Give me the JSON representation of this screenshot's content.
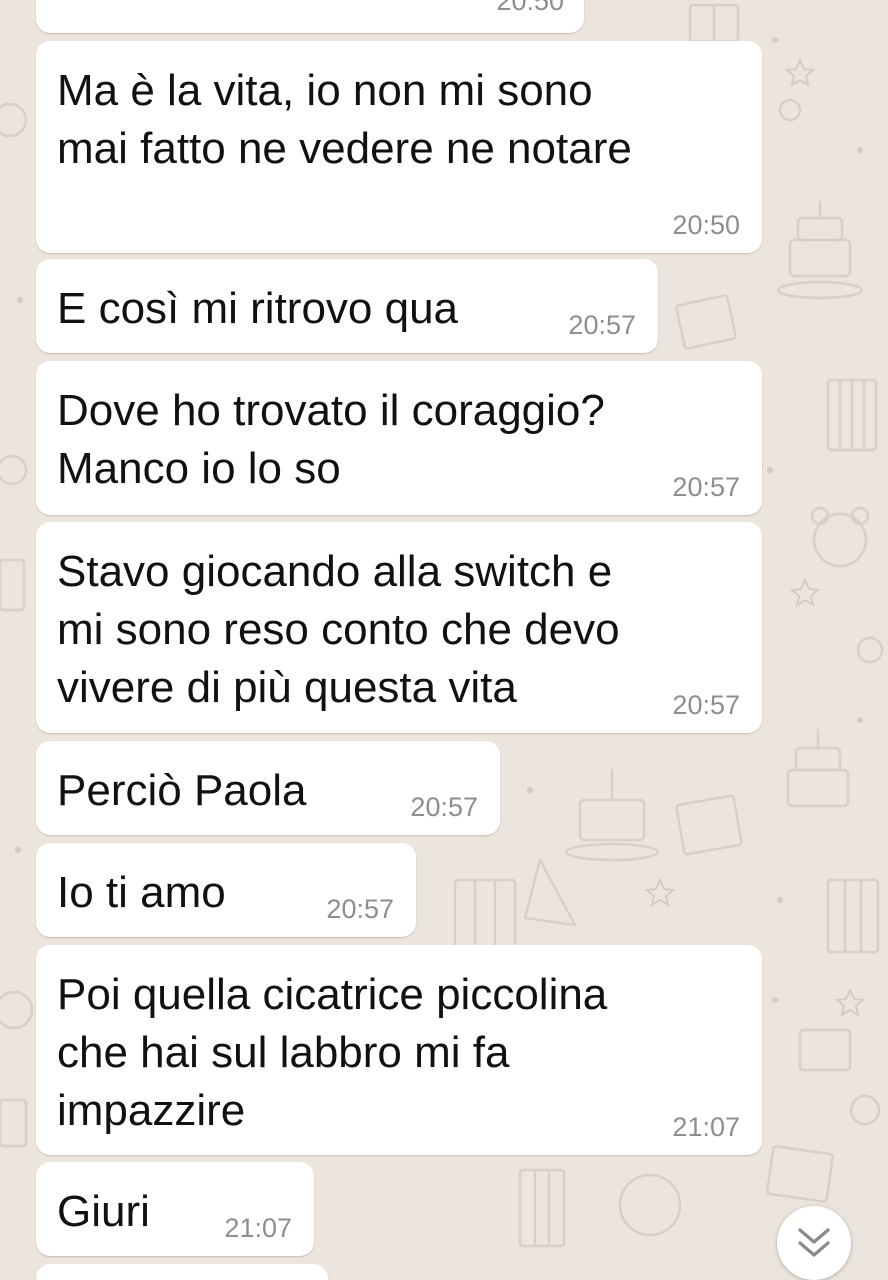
{
  "app": {
    "accent_color": "#8e8e8e",
    "wallpaper_color": "#ece5dd",
    "bubble_color": "#ffffff"
  },
  "messages": [
    {
      "text": "",
      "time": "20:50",
      "partial": "top-cropped"
    },
    {
      "text": "Ma è la vita, io non mi sono\nmai fatto ne vedere ne notare",
      "time": "20:50"
    },
    {
      "text": "E così mi ritrovo qua",
      "time": "20:57"
    },
    {
      "text": "Dove ho trovato il coraggio?\nManco io lo so",
      "time": "20:57"
    },
    {
      "text": "Stavo giocando alla switch e\nmi sono reso conto che devo\nvivere di più questa vita",
      "time": "20:57"
    },
    {
      "text": "Perciò Paola",
      "time": "20:57"
    },
    {
      "text": "Io ti amo",
      "time": "20:57"
    },
    {
      "text": "Poi quella cicatrice piccolina\nche hai sul labbro mi fa\nimpazzire",
      "time": "21:07"
    },
    {
      "text": "Giuri",
      "time": "21:07"
    },
    {
      "text": "",
      "time": "",
      "partial": "bottom-cropped"
    }
  ],
  "scroll_button": {
    "icon": "double-chevron-down-icon"
  }
}
